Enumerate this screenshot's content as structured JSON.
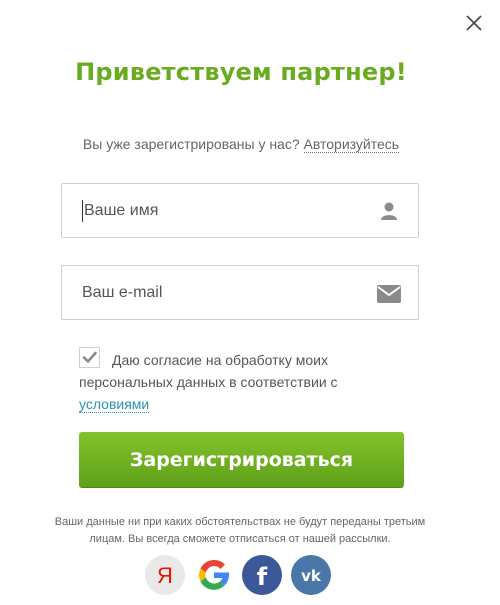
{
  "modal": {
    "title": "Приветствуем партнер!",
    "login_prompt": "Вы уже зарегистрированы у нас?",
    "login_link": "Авторизуйтесь"
  },
  "form": {
    "name_placeholder": "Ваше имя",
    "name_value": "",
    "email_placeholder": "Ваш e-mail",
    "email_value": "",
    "consent_checked": true,
    "consent_text": "Даю согласие на обработку моих персональных данных в соответствии с",
    "consent_link": "условиями",
    "submit_label": "Зарегистрироваться"
  },
  "footer": {
    "disclaimer": "Ваши данные ни при каких обстоятельствах не будут переданы третьим лицам. Вы всегда сможете отписаться от нашей рассылки."
  },
  "socials": [
    {
      "name": "yandex-icon",
      "glyph": "Я"
    },
    {
      "name": "google-icon",
      "glyph": "G"
    },
    {
      "name": "facebook-icon",
      "glyph": "f"
    },
    {
      "name": "vk-icon",
      "glyph": "vk"
    }
  ],
  "colors": {
    "title_green": "#6aac1f",
    "button_green": "#6fb123",
    "link_blue": "#2a93b8",
    "facebook_blue": "#3b5998",
    "vk_blue": "#4a76a8"
  }
}
